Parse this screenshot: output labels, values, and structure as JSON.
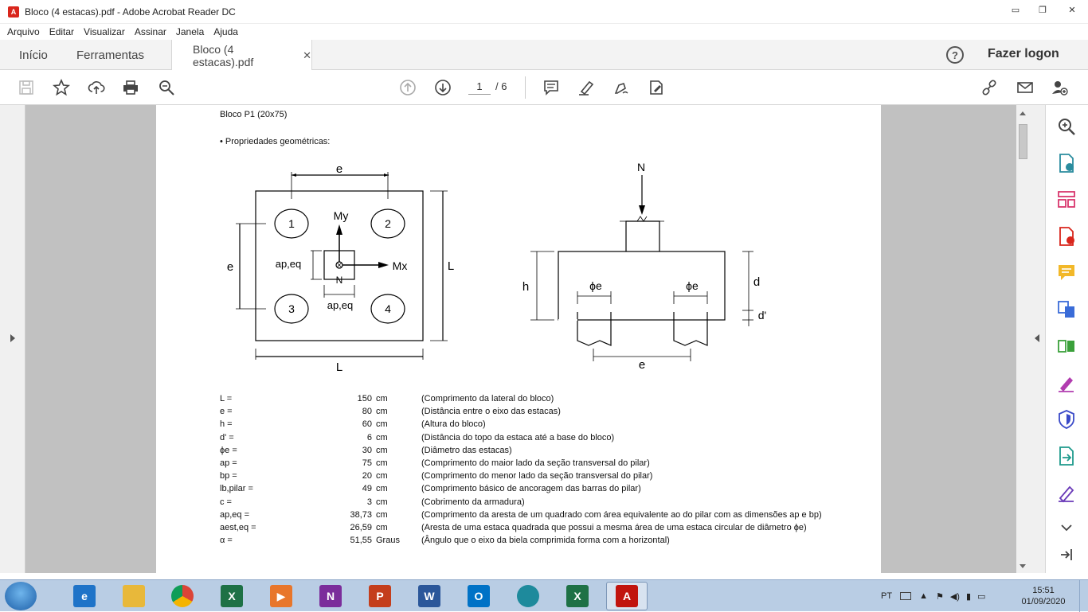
{
  "window": {
    "title": "Bloco (4 estacas).pdf - Adobe Acrobat Reader DC",
    "app_icon_glyph": "A",
    "minimize_glyph": "▭",
    "maximize_glyph": "❐",
    "close_glyph": "✕"
  },
  "menu": [
    "Arquivo",
    "Editar",
    "Visualizar",
    "Assinar",
    "Janela",
    "Ajuda"
  ],
  "tabs": {
    "home": "Início",
    "tools": "Ferramentas",
    "document": "Bloco (4 estacas).pdf",
    "close_glyph": "✕",
    "help_glyph": "?",
    "logon": "Fazer logon"
  },
  "toolbar": {
    "current_page": "1",
    "total_pages": "/ 6",
    "icons": [
      "save-icon",
      "star-icon",
      "upload-icon",
      "print-icon",
      "zoom-search-icon",
      "page-up-icon",
      "page-down-icon",
      "comment-icon",
      "highlight-icon",
      "sign-icon",
      "fill-sign-icon",
      "share-link-icon",
      "email-icon",
      "add-user-icon"
    ]
  },
  "document": {
    "heading": "Bloco P1 (20x75)",
    "subheading": "• Propriedades geométricas:",
    "diagram_labels": {
      "e_top": "e",
      "e_left": "e",
      "L_right": "L",
      "L_bottom": "L",
      "pile1": "1",
      "pile2": "2",
      "pile3": "3",
      "pile4": "4",
      "My": "My",
      "Mx": "Mx",
      "N_plan": "N",
      "ap_eq_left": "ap,eq",
      "ap_eq_bottom": "ap,eq",
      "N_section": "N",
      "h": "h",
      "d": "d",
      "d_prime": "d'",
      "phi_e_left": "ϕe",
      "phi_e_right": "ϕe",
      "e_section": "e"
    },
    "properties": [
      {
        "sym": "L =",
        "val": "150",
        "unit": "cm",
        "desc": "(Comprimento da lateral do bloco)"
      },
      {
        "sym": "e =",
        "val": "80",
        "unit": "cm",
        "desc": "(Distância entre o eixo das estacas)"
      },
      {
        "sym": "h =",
        "val": "60",
        "unit": "cm",
        "desc": "(Altura do bloco)"
      },
      {
        "sym": "d' =",
        "val": "6",
        "unit": "cm",
        "desc": "(Distância do topo da estaca até a base do bloco)"
      },
      {
        "sym": "ϕe =",
        "val": "30",
        "unit": "cm",
        "desc": "(Diâmetro das estacas)"
      },
      {
        "sym": "ap =",
        "val": "75",
        "unit": "cm",
        "desc": "(Comprimento do maior lado da seção transversal do pilar)"
      },
      {
        "sym": "bp =",
        "val": "20",
        "unit": "cm",
        "desc": "(Comprimento do menor lado da seção transversal do pilar)"
      },
      {
        "sym": "lb,pilar =",
        "val": "49",
        "unit": "cm",
        "desc": "(Comprimento básico de ancoragem das barras do pilar)"
      },
      {
        "sym": "c =",
        "val": "3",
        "unit": "cm",
        "desc": "(Cobrimento da armadura)"
      },
      {
        "sym": "ap,eq =",
        "val": "38,73",
        "unit": "cm",
        "desc": "(Comprimento da aresta de um quadrado com área equivalente ao do pilar com as dimensões ap e bp)"
      },
      {
        "sym": "aest,eq =",
        "val": "26,59",
        "unit": "cm",
        "desc": "(Aresta de uma estaca quadrada que possui a mesma área de uma estaca circular de diâmetro ϕe)"
      },
      {
        "sym": "α =",
        "val": "51,55",
        "unit": "Graus",
        "desc": "(Ângulo que o eixo da biela comprimida forma com a horizontal)"
      }
    ]
  },
  "taskbar": {
    "apps": [
      {
        "name": "ie",
        "glyph": "e",
        "color": "#1e73c8"
      },
      {
        "name": "explorer",
        "glyph": "",
        "color": "#e8b83a"
      },
      {
        "name": "chrome",
        "glyph": "",
        "color": "#db4437"
      },
      {
        "name": "excel",
        "glyph": "X",
        "color": "#1e7145"
      },
      {
        "name": "media",
        "glyph": "▶",
        "color": "#e8762b"
      },
      {
        "name": "onenote",
        "glyph": "N",
        "color": "#7b2d9b"
      },
      {
        "name": "powerpoint",
        "glyph": "P",
        "color": "#c43e1c"
      },
      {
        "name": "word",
        "glyph": "W",
        "color": "#2b579a"
      },
      {
        "name": "outlook",
        "glyph": "O",
        "color": "#0072c6"
      },
      {
        "name": "edge",
        "glyph": "",
        "color": "#1e8a9c"
      },
      {
        "name": "excel2",
        "glyph": "X",
        "color": "#1e7145"
      },
      {
        "name": "acrobat",
        "glyph": "A",
        "color": "#c1140d"
      }
    ],
    "lang": "PT",
    "time": "15:51",
    "date": "01/09/2020"
  }
}
